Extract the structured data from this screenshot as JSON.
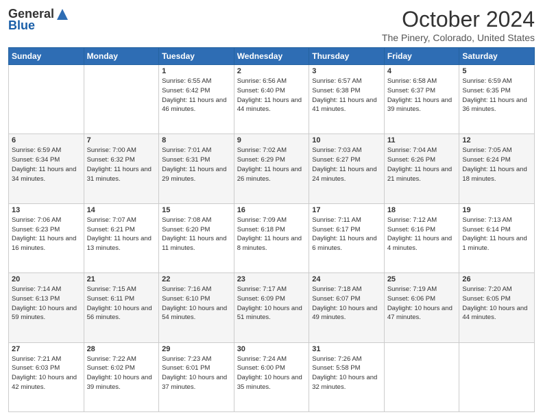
{
  "logo": {
    "general": "General",
    "blue": "Blue"
  },
  "header": {
    "month": "October 2024",
    "location": "The Pinery, Colorado, United States"
  },
  "weekdays": [
    "Sunday",
    "Monday",
    "Tuesday",
    "Wednesday",
    "Thursday",
    "Friday",
    "Saturday"
  ],
  "weeks": [
    [
      {
        "day": "",
        "info": ""
      },
      {
        "day": "",
        "info": ""
      },
      {
        "day": "1",
        "info": "Sunrise: 6:55 AM\nSunset: 6:42 PM\nDaylight: 11 hours and 46 minutes."
      },
      {
        "day": "2",
        "info": "Sunrise: 6:56 AM\nSunset: 6:40 PM\nDaylight: 11 hours and 44 minutes."
      },
      {
        "day": "3",
        "info": "Sunrise: 6:57 AM\nSunset: 6:38 PM\nDaylight: 11 hours and 41 minutes."
      },
      {
        "day": "4",
        "info": "Sunrise: 6:58 AM\nSunset: 6:37 PM\nDaylight: 11 hours and 39 minutes."
      },
      {
        "day": "5",
        "info": "Sunrise: 6:59 AM\nSunset: 6:35 PM\nDaylight: 11 hours and 36 minutes."
      }
    ],
    [
      {
        "day": "6",
        "info": "Sunrise: 6:59 AM\nSunset: 6:34 PM\nDaylight: 11 hours and 34 minutes."
      },
      {
        "day": "7",
        "info": "Sunrise: 7:00 AM\nSunset: 6:32 PM\nDaylight: 11 hours and 31 minutes."
      },
      {
        "day": "8",
        "info": "Sunrise: 7:01 AM\nSunset: 6:31 PM\nDaylight: 11 hours and 29 minutes."
      },
      {
        "day": "9",
        "info": "Sunrise: 7:02 AM\nSunset: 6:29 PM\nDaylight: 11 hours and 26 minutes."
      },
      {
        "day": "10",
        "info": "Sunrise: 7:03 AM\nSunset: 6:27 PM\nDaylight: 11 hours and 24 minutes."
      },
      {
        "day": "11",
        "info": "Sunrise: 7:04 AM\nSunset: 6:26 PM\nDaylight: 11 hours and 21 minutes."
      },
      {
        "day": "12",
        "info": "Sunrise: 7:05 AM\nSunset: 6:24 PM\nDaylight: 11 hours and 18 minutes."
      }
    ],
    [
      {
        "day": "13",
        "info": "Sunrise: 7:06 AM\nSunset: 6:23 PM\nDaylight: 11 hours and 16 minutes."
      },
      {
        "day": "14",
        "info": "Sunrise: 7:07 AM\nSunset: 6:21 PM\nDaylight: 11 hours and 13 minutes."
      },
      {
        "day": "15",
        "info": "Sunrise: 7:08 AM\nSunset: 6:20 PM\nDaylight: 11 hours and 11 minutes."
      },
      {
        "day": "16",
        "info": "Sunrise: 7:09 AM\nSunset: 6:18 PM\nDaylight: 11 hours and 8 minutes."
      },
      {
        "day": "17",
        "info": "Sunrise: 7:11 AM\nSunset: 6:17 PM\nDaylight: 11 hours and 6 minutes."
      },
      {
        "day": "18",
        "info": "Sunrise: 7:12 AM\nSunset: 6:16 PM\nDaylight: 11 hours and 4 minutes."
      },
      {
        "day": "19",
        "info": "Sunrise: 7:13 AM\nSunset: 6:14 PM\nDaylight: 11 hours and 1 minute."
      }
    ],
    [
      {
        "day": "20",
        "info": "Sunrise: 7:14 AM\nSunset: 6:13 PM\nDaylight: 10 hours and 59 minutes."
      },
      {
        "day": "21",
        "info": "Sunrise: 7:15 AM\nSunset: 6:11 PM\nDaylight: 10 hours and 56 minutes."
      },
      {
        "day": "22",
        "info": "Sunrise: 7:16 AM\nSunset: 6:10 PM\nDaylight: 10 hours and 54 minutes."
      },
      {
        "day": "23",
        "info": "Sunrise: 7:17 AM\nSunset: 6:09 PM\nDaylight: 10 hours and 51 minutes."
      },
      {
        "day": "24",
        "info": "Sunrise: 7:18 AM\nSunset: 6:07 PM\nDaylight: 10 hours and 49 minutes."
      },
      {
        "day": "25",
        "info": "Sunrise: 7:19 AM\nSunset: 6:06 PM\nDaylight: 10 hours and 47 minutes."
      },
      {
        "day": "26",
        "info": "Sunrise: 7:20 AM\nSunset: 6:05 PM\nDaylight: 10 hours and 44 minutes."
      }
    ],
    [
      {
        "day": "27",
        "info": "Sunrise: 7:21 AM\nSunset: 6:03 PM\nDaylight: 10 hours and 42 minutes."
      },
      {
        "day": "28",
        "info": "Sunrise: 7:22 AM\nSunset: 6:02 PM\nDaylight: 10 hours and 39 minutes."
      },
      {
        "day": "29",
        "info": "Sunrise: 7:23 AM\nSunset: 6:01 PM\nDaylight: 10 hours and 37 minutes."
      },
      {
        "day": "30",
        "info": "Sunrise: 7:24 AM\nSunset: 6:00 PM\nDaylight: 10 hours and 35 minutes."
      },
      {
        "day": "31",
        "info": "Sunrise: 7:26 AM\nSunset: 5:58 PM\nDaylight: 10 hours and 32 minutes."
      },
      {
        "day": "",
        "info": ""
      },
      {
        "day": "",
        "info": ""
      }
    ]
  ]
}
